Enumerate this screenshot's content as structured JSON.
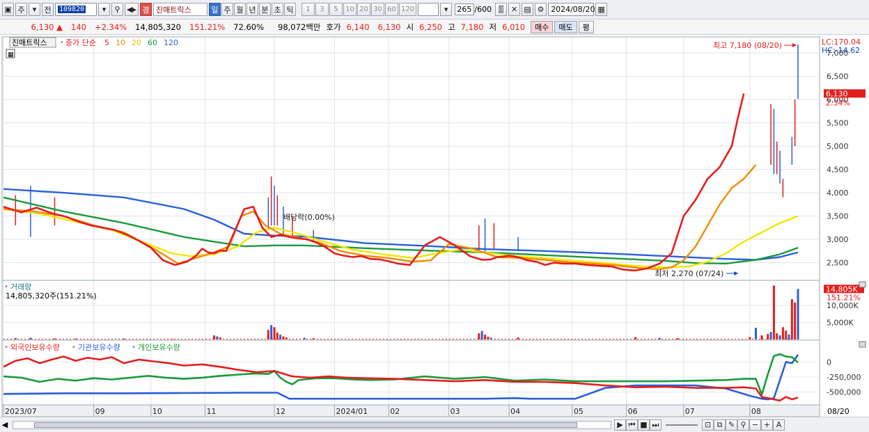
{
  "toolbar": {
    "btn_main": "주",
    "btn_prev": "전",
    "code": "109820",
    "badge": "경",
    "stock_name": "진매트릭스",
    "periods": [
      "일",
      "주",
      "월",
      "년",
      "분",
      "초",
      "틱"
    ],
    "active_period": "일",
    "intervals": [
      "1",
      "3",
      "5",
      "10",
      "20",
      "30",
      "60",
      "120"
    ],
    "count": "265",
    "count_total": "/600",
    "date": "2024/08/20"
  },
  "quote": {
    "price": "6,130",
    "change": "140",
    "change_pct": "+2.34%",
    "volume": "14,805,320",
    "volume_ratio": "151.21%",
    "turnover": "72.60%",
    "amount": "98,072백만",
    "bid_label": "호가",
    "bid": "6,140",
    "ask": "6,130",
    "open_label": "시",
    "open": "6,250",
    "high_label": "고",
    "high": "7,180",
    "low_label": "저",
    "low": "6,010",
    "buy_label": "매수",
    "sell_label": "매도",
    "eval_label": "평"
  },
  "chart_data": {
    "type": "line",
    "price_panel": {
      "title": "진매트릭스",
      "ma_title": "종가 단순",
      "ma_periods": [
        {
          "label": "5",
          "color": "#e41d1d"
        },
        {
          "label": "10",
          "color": "#f08c00"
        },
        {
          "label": "20",
          "color": "#f2e600"
        },
        {
          "label": "60",
          "color": "#1b9a3a"
        },
        {
          "label": "120",
          "color": "#2a5fd9"
        }
      ],
      "ylim": [
        2150,
        7300
      ],
      "yticks": [
        2500,
        3000,
        3500,
        4000,
        4500,
        5000,
        5500,
        6000,
        6500,
        7000
      ],
      "ytick_labels": [
        "2,500",
        "3,000",
        "3,500",
        "4,000",
        "4,500",
        "5,000",
        "5,500",
        "6,000",
        "6,500",
        "7,000"
      ],
      "lc_label": "LC:170.04",
      "hc_label": "HC:-14.62",
      "price_tag": "6,130",
      "pct_tag": "2.34%",
      "high_annot": "최고 7,180 (08/20)",
      "low_annot": "최저 2,270 (07/24)",
      "event_annot": "배당락(0.00%)",
      "ma5": {
        "x": [
          0,
          6,
          11,
          16,
          21,
          25,
          29,
          33,
          37,
          41,
          45,
          49,
          53,
          57,
          61,
          64,
          66,
          68,
          70,
          72,
          74,
          77,
          80,
          83,
          86,
          89,
          92,
          95,
          98,
          101,
          104,
          107,
          110,
          113,
          116,
          119,
          122,
          125,
          128,
          131,
          135,
          140,
          145,
          150,
          155,
          159,
          162,
          164,
          166,
          168,
          170,
          172,
          174,
          177,
          180,
          183,
          186,
          190,
          194,
          198,
          202,
          206,
          210,
          214,
          218,
          222,
          226,
          230,
          234,
          238,
          242,
          244,
          246,
          248,
          250,
          252,
          254,
          256,
          258,
          260,
          262,
          264
        ],
        "y": [
          3700,
          3580,
          3680,
          3560,
          3480,
          3380,
          3300,
          3250,
          3200,
          3100,
          2970,
          2820,
          2550,
          2450,
          2520,
          2650,
          2800,
          2720,
          2700,
          2760,
          2750,
          3200,
          3650,
          3700,
          3250,
          3050,
          3100,
          3050,
          3020,
          3000,
          2930,
          2830,
          2700,
          2650,
          2620,
          2640,
          2580,
          2570,
          2530,
          2480,
          2450,
          2870,
          3050,
          2870,
          2640,
          2560,
          2570,
          2620,
          2630,
          2650,
          2630,
          2600,
          2550,
          2520,
          2450,
          2500,
          2480,
          2480,
          2450,
          2430,
          2420,
          2350,
          2330,
          2380,
          2480,
          2700,
          3500,
          3850,
          4300,
          4550,
          5000,
          5600,
          6130
        ]
      },
      "ma10": {
        "x": [
          0,
          10,
          20,
          30,
          40,
          50,
          58,
          64,
          70,
          75,
          79,
          83,
          87,
          92,
          98,
          105,
          112,
          120,
          128,
          136,
          142,
          148,
          156,
          164,
          172,
          180,
          188,
          196,
          204,
          212,
          218,
          222,
          226,
          230,
          234,
          238,
          242,
          246,
          250,
          254,
          258,
          262,
          264
        ],
        "y": [
          3650,
          3600,
          3500,
          3300,
          3150,
          2800,
          2480,
          2600,
          2720,
          2850,
          3500,
          3600,
          3300,
          3120,
          3040,
          2930,
          2750,
          2650,
          2600,
          2520,
          2550,
          2900,
          2800,
          2620,
          2600,
          2560,
          2510,
          2480,
          2440,
          2380,
          2360,
          2400,
          2550,
          2850,
          3300,
          3750,
          4100,
          4300,
          4600
        ]
      },
      "ma20": {
        "x": [
          0,
          12,
          24,
          36,
          48,
          56,
          62,
          70,
          78,
          84,
          90,
          98,
          106,
          116,
          126,
          136,
          144,
          152,
          160,
          170,
          180,
          190,
          200,
          210,
          220,
          228,
          234,
          240,
          246,
          252,
          258,
          264
        ],
        "y": [
          3650,
          3550,
          3380,
          3200,
          2900,
          2700,
          2640,
          2680,
          2850,
          3150,
          3250,
          3120,
          2960,
          2780,
          2680,
          2600,
          2700,
          2780,
          2720,
          2640,
          2600,
          2540,
          2490,
          2430,
          2400,
          2420,
          2520,
          2700,
          2950,
          3150,
          3350,
          3500
        ]
      },
      "ma60": {
        "x": [
          0,
          20,
          40,
          60,
          70,
          80,
          90,
          100,
          110,
          120,
          140,
          160,
          180,
          200,
          220,
          230,
          240,
          250,
          258,
          264
        ],
        "y": [
          3900,
          3600,
          3350,
          3050,
          2950,
          2850,
          2870,
          2870,
          2840,
          2810,
          2760,
          2720,
          2660,
          2600,
          2540,
          2490,
          2480,
          2560,
          2680,
          2820
        ]
      },
      "ma120": {
        "x": [
          0,
          20,
          40,
          60,
          70,
          80,
          90,
          100,
          110,
          120,
          140,
          160,
          180,
          200,
          220,
          240,
          250,
          258,
          264
        ],
        "y": [
          4080,
          4000,
          3900,
          3650,
          3420,
          3120,
          3080,
          3060,
          2990,
          2920,
          2860,
          2790,
          2750,
          2700,
          2640,
          2580,
          2560,
          2620,
          2720
        ]
      },
      "spikes": {
        "x": [
          4,
          9,
          17,
          88,
          89,
          90,
          91,
          93,
          96,
          103,
          158,
          160,
          163,
          171,
          255,
          256,
          257,
          258,
          259,
          262,
          263,
          264
        ],
        "high": [
          3950,
          4150,
          3900,
          3900,
          4350,
          4150,
          3950,
          3700,
          3500,
          3200,
          3300,
          3450,
          3350,
          3050,
          5900,
          5800,
          5100,
          4900,
          4300,
          5200,
          6000,
          7180
        ],
        "low": [
          3300,
          3050,
          3300,
          3200,
          3300,
          3300,
          3300,
          3100,
          3050,
          2950,
          2750,
          2700,
          2780,
          2750,
          4600,
          4400,
          4400,
          4200,
          3900,
          4600,
          5000,
          6010
        ]
      }
    },
    "volume_panel": {
      "title": "거래량",
      "current": "14,805,320주(151.21%)",
      "ylim": [
        0,
        16500
      ],
      "yticks": [
        5000,
        10000
      ],
      "ytick_labels": [
        "5,000K",
        "10,000K"
      ],
      "tag_value": "14,805K",
      "tag_pct": "151.21%",
      "bars": {
        "x": [
          4,
          9,
          17,
          24,
          40,
          56,
          70,
          71,
          72,
          88,
          89,
          90,
          91,
          92,
          93,
          94,
          100,
          103,
          158,
          159,
          160,
          161,
          162,
          171,
          210,
          218,
          224,
          248,
          250,
          252,
          254,
          255,
          256,
          257,
          258,
          259,
          260,
          261,
          262,
          263,
          264
        ],
        "values": [
          400,
          500,
          300,
          250,
          300,
          200,
          1200,
          900,
          600,
          2800,
          4200,
          3600,
          2000,
          1400,
          900,
          600,
          500,
          400,
          1800,
          2500,
          1400,
          800,
          500,
          600,
          700,
          500,
          400,
          700,
          3400,
          1200,
          1600,
          2200,
          15800,
          1800,
          1200,
          3600,
          2600,
          1500,
          11800,
          10800,
          14805
        ]
      }
    },
    "holdings_panel": {
      "series_labels": [
        "외국인보유수량",
        "기관보유수량",
        "개인보유수량"
      ],
      "series_colors": [
        "#e41d1d",
        "#2a5fd9",
        "#1b9a3a"
      ],
      "ylim": [
        -700000,
        200000
      ],
      "yticks": [
        0,
        -250000,
        -500000
      ],
      "ytick_labels": [
        "0",
        "-250,000",
        "-500,000"
      ],
      "foreign": {
        "x": [
          0,
          4,
          8,
          12,
          16,
          20,
          24,
          28,
          32,
          36,
          40,
          45,
          50,
          55,
          60,
          66,
          72,
          78,
          84,
          90,
          96,
          102,
          108,
          114,
          120,
          130,
          140,
          150,
          160,
          170,
          180,
          190,
          200,
          210,
          220,
          230,
          240,
          246,
          250,
          252,
          254,
          256,
          258,
          260,
          262,
          264
        ],
        "y": [
          -80000,
          20000,
          60000,
          -20000,
          40000,
          90000,
          20000,
          70000,
          40000,
          80000,
          -20000,
          40000,
          10000,
          -20000,
          -60000,
          -40000,
          -80000,
          -130000,
          -170000,
          -150000,
          -240000,
          -260000,
          -240000,
          -260000,
          -270000,
          -280000,
          -300000,
          -320000,
          -300000,
          -330000,
          -330000,
          -350000,
          -390000,
          -420000,
          -410000,
          -430000,
          -430000,
          -420000,
          -440000,
          -580000,
          -600000,
          -620000,
          -640000,
          -580000,
          -620000,
          -590000
        ]
      },
      "institution": {
        "x": [
          0,
          20,
          40,
          60,
          80,
          91,
          95,
          100,
          120,
          140,
          160,
          170,
          175,
          180,
          190,
          200,
          210,
          230,
          240,
          248,
          252,
          254,
          256,
          258,
          260,
          262,
          264
        ],
        "y": [
          -530000,
          -520000,
          -520000,
          -515000,
          -510000,
          -510000,
          -610000,
          -610000,
          -610000,
          -610000,
          -610000,
          -600000,
          -610000,
          -610000,
          -610000,
          -430000,
          -390000,
          -390000,
          -440000,
          -560000,
          -610000,
          -620000,
          -600000,
          -300000,
          0,
          -20000,
          120000
        ]
      },
      "individual": {
        "x": [
          0,
          6,
          12,
          18,
          24,
          30,
          36,
          42,
          48,
          54,
          60,
          66,
          72,
          78,
          84,
          88,
          90,
          92,
          94,
          96,
          98,
          100,
          104,
          110,
          116,
          122,
          130,
          140,
          150,
          160,
          170,
          180,
          190,
          200,
          210,
          220,
          230,
          240,
          246,
          250,
          252,
          254,
          256,
          258,
          260,
          262,
          264
        ],
        "y": [
          -240000,
          -260000,
          -330000,
          -280000,
          -310000,
          -270000,
          -290000,
          -260000,
          -230000,
          -260000,
          -280000,
          -260000,
          -230000,
          -210000,
          -190000,
          -200000,
          -150000,
          -260000,
          -330000,
          -370000,
          -300000,
          -290000,
          -270000,
          -270000,
          -290000,
          -300000,
          -290000,
          -240000,
          -280000,
          -250000,
          -310000,
          -290000,
          -320000,
          -320000,
          -320000,
          -320000,
          -310000,
          -300000,
          -280000,
          -280000,
          -540000,
          -200000,
          100000,
          130000,
          90000,
          80000,
          -10000
        ]
      }
    },
    "x_axis": {
      "labels": [
        "2023/07",
        "09",
        "10",
        "11",
        "12",
        "2024/01",
        "02",
        "03",
        "04",
        "05",
        "06",
        "07",
        "08"
      ],
      "positions": [
        0,
        30,
        49,
        67,
        90,
        110,
        128,
        148,
        168,
        189,
        207,
        226,
        248
      ],
      "current_label": "08/20",
      "n_points": 265
    }
  },
  "bottombar": {
    "icons": [
      "play-icon",
      "first-icon",
      "stop-icon",
      "last-icon",
      "zoom-icon",
      "minus-icon",
      "plus-icon",
      "font-icon"
    ]
  }
}
